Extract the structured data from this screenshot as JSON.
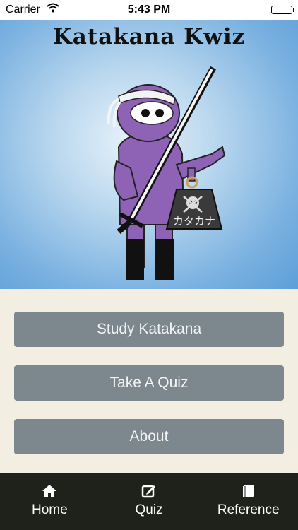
{
  "status_bar": {
    "carrier": "Carrier",
    "time": "5:43 PM"
  },
  "hero": {
    "title": "Katakana Kwiz",
    "weight_label": "カタカナ"
  },
  "menu": {
    "study_label": "Study Katakana",
    "quiz_label": "Take A Quiz",
    "about_label": "About"
  },
  "tab_bar": {
    "items": [
      {
        "label": "Home",
        "icon": "home-icon"
      },
      {
        "label": "Quiz",
        "icon": "edit-icon"
      },
      {
        "label": "Reference",
        "icon": "book-icon"
      }
    ]
  },
  "colors": {
    "hero_sky": "#78b0e0",
    "button": "#7c878e",
    "tab_bar": "#1f211b",
    "background": "#f2efe2",
    "ninja_purple": "#8e63b6"
  }
}
